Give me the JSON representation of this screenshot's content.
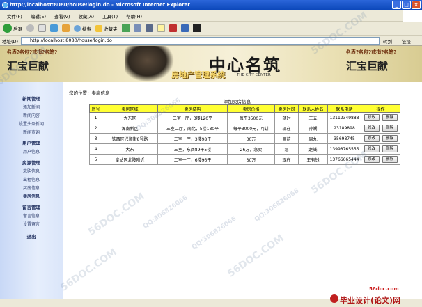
{
  "window": {
    "title": "http://localhost:8080/house/login.do - Microsoft Internet Explorer"
  },
  "menu": [
    "文件(F)",
    "编辑(E)",
    "查看(V)",
    "收藏(A)",
    "工具(T)",
    "帮助(H)"
  ],
  "toolbar": {
    "back": "后退",
    "search": "搜索",
    "favorites": "收藏夹"
  },
  "address": {
    "label": "地址(D)",
    "url": "http://localhost:8080/house/login.do",
    "go": "转到",
    "links": "链接"
  },
  "banner": {
    "left_small": "名表?名包?戒指?名笔?",
    "left_big": "汇宝巨献",
    "brand": "中心名筑",
    "tagline": "THE CITY CENTER",
    "system": "房地产管理系统",
    "right_small": "名表?名包?戒指?名笔?",
    "right_big": "汇宝巨献"
  },
  "sidebar": [
    {
      "section": "新闻管理",
      "items": [
        "添加新闻",
        "新闻内容",
        "设置头条新闻",
        "新闻查询"
      ]
    },
    {
      "section": "用户管理",
      "items": [
        "用户信息"
      ]
    },
    {
      "section": "房源管理",
      "items": [
        "求购信息",
        "出租信息",
        "买房信息",
        "卖房信息"
      ]
    },
    {
      "section": "留言管理",
      "items": [
        "留言信息",
        "设置留言"
      ]
    },
    {
      "section": "退出",
      "items": []
    }
  ],
  "content": {
    "location": "您的位置：卖房信息",
    "caption": "添加卖房信息",
    "headers": [
      "序号",
      "卖房区域",
      "卖房结构",
      "卖房价格",
      "卖房时间",
      "联系人姓名",
      "联系电话",
      "操作"
    ],
    "rows": [
      [
        "1",
        "大东区",
        "二室一厅，3楼120平",
        "每平3500元",
        "随时",
        "王五",
        "13112349888"
      ],
      [
        "2",
        "浑南新区",
        "三室二厅，南北，5楼180平",
        "每平3000元，可讲",
        "现在",
        "孙娴",
        "23189898"
      ],
      [
        "3",
        "铁西区兴顺街8号路",
        "二室一厅，3楼98平",
        "30万",
        "目前",
        "周九",
        "35698745"
      ],
      [
        "4",
        "大东",
        "三室，东西89平5楼",
        "26万，急卖",
        "急",
        "赵钱",
        "13998765555"
      ],
      [
        "5",
        "皇姑区北陵附近",
        "二室一厅，6楼96平",
        "30万",
        "现在",
        "王有钱",
        "13766665444"
      ]
    ],
    "edit_label": "修改",
    "delete_label": "删除"
  },
  "watermark": {
    "site": "56DOC.COM",
    "qq": "QQ:306826066"
  },
  "footer_logo": {
    "url": "56doc.com",
    "name": "毕业设计(论文)网"
  }
}
